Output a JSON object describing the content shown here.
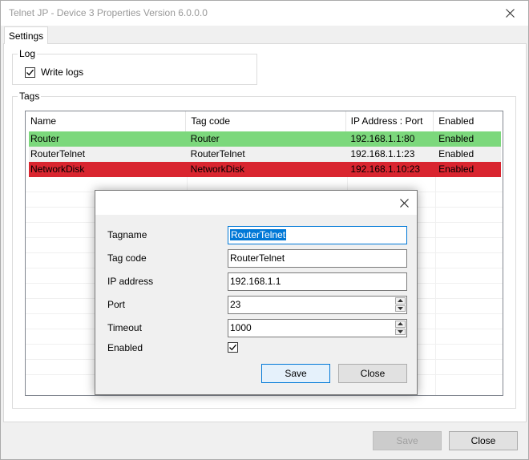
{
  "window": {
    "title": "Telnet JP - Device 3 Properties Version 6.0.0.0"
  },
  "tabs": [
    {
      "label": "Settings"
    }
  ],
  "log": {
    "group_label": "Log",
    "write_logs_label": "Write logs",
    "write_logs_checked": true
  },
  "tags": {
    "group_label": "Tags",
    "columns": [
      "Name",
      "Tag code",
      "IP Address : Port",
      "Enabled"
    ],
    "rows": [
      {
        "name": "Router",
        "tag_code": "Router",
        "address": "192.168.1.1:80",
        "enabled": "Enabled",
        "color": "#7cd87c"
      },
      {
        "name": "RouterTelnet",
        "tag_code": "RouterTelnet",
        "address": "192.168.1.1:23",
        "enabled": "Enabled",
        "color": "#f0f0f0"
      },
      {
        "name": "NetworkDisk",
        "tag_code": "NetworkDisk",
        "address": "192.168.1.10:23",
        "enabled": "Enabled",
        "color": "#d9252f"
      }
    ]
  },
  "footer": {
    "save_label": "Save",
    "close_label": "Close"
  },
  "dialog": {
    "tagname_label": "Tagname",
    "tagname_value": "RouterTelnet",
    "tagcode_label": "Tag code",
    "tagcode_value": "RouterTelnet",
    "ip_label": "IP address",
    "ip_value": "192.168.1.1",
    "port_label": "Port",
    "port_value": "23",
    "timeout_label": "Timeout",
    "timeout_value": "1000",
    "enabled_label": "Enabled",
    "enabled_checked": true,
    "save_label": "Save",
    "close_label": "Close"
  },
  "icons": {
    "window_close": "close-icon",
    "dialog_close": "close-icon",
    "checkmark": "check-icon"
  }
}
